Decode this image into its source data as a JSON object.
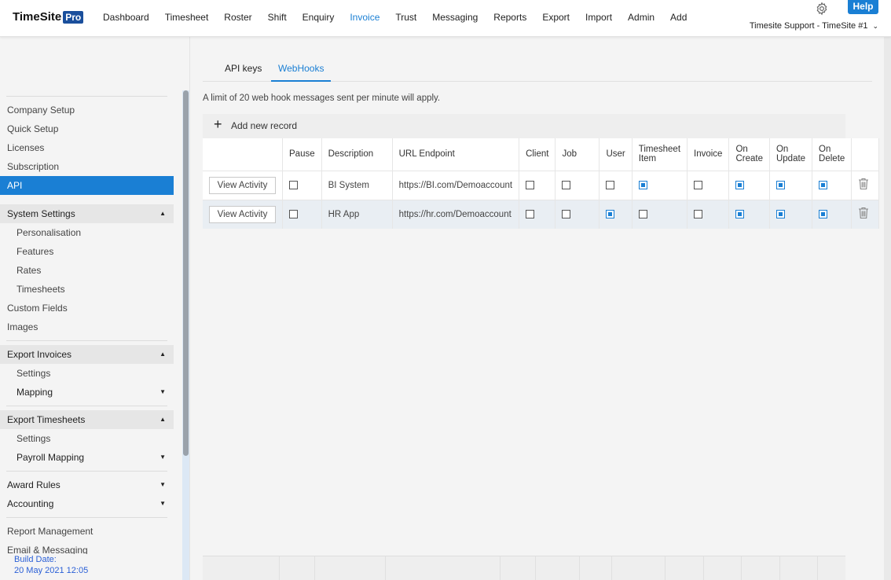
{
  "header": {
    "logo_text": "TimeSite",
    "logo_badge": "Pro",
    "nav": [
      "Dashboard",
      "Timesheet",
      "Roster",
      "Shift",
      "Enquiry",
      "Invoice",
      "Trust",
      "Messaging",
      "Reports",
      "Export",
      "Import",
      "Admin",
      "Add"
    ],
    "active_nav": "Invoice",
    "help_label": "Help",
    "account_label": "Timesite Support - TimeSite #1",
    "accent_color": "#1a7fd4"
  },
  "sidebar": {
    "items": [
      {
        "label": "Company Setup"
      },
      {
        "label": "Quick Setup"
      },
      {
        "label": "Licenses"
      },
      {
        "label": "Subscription"
      },
      {
        "label": "API"
      },
      {
        "label": "System Settings"
      },
      {
        "label": "Personalisation"
      },
      {
        "label": "Features"
      },
      {
        "label": "Rates"
      },
      {
        "label": "Timesheets"
      },
      {
        "label": "Custom Fields"
      },
      {
        "label": "Images"
      },
      {
        "label": "Export Invoices"
      },
      {
        "label": "Settings"
      },
      {
        "label": "Mapping"
      },
      {
        "label": "Export Timesheets"
      },
      {
        "label": "Settings"
      },
      {
        "label": "Payroll Mapping"
      },
      {
        "label": "Award Rules"
      },
      {
        "label": "Accounting"
      },
      {
        "label": "Report Management"
      },
      {
        "label": "Email & Messaging"
      }
    ],
    "build_label": "Build Date:",
    "build_date": "20 May 2021 12:05"
  },
  "main": {
    "tabs": [
      {
        "label": "API keys"
      },
      {
        "label": "WebHooks"
      }
    ],
    "active_tab": "WebHooks",
    "limit_note": "A limit of 20 web hook messages sent per minute will apply.",
    "add_label": "Add new record",
    "columns": [
      "",
      "Pause",
      "Description",
      "URL Endpoint",
      "Client",
      "Job",
      "User",
      "Timesheet Item",
      "Invoice",
      "On Create",
      "On Update",
      "On Delete",
      ""
    ],
    "rows": [
      {
        "action": "View Activity",
        "pause": false,
        "description": "BI System",
        "url": "https://BI.com/Demoaccount",
        "client": false,
        "job": false,
        "user": false,
        "timesheet_item": true,
        "invoice": false,
        "on_create": true,
        "on_update": true,
        "on_delete": true
      },
      {
        "action": "View Activity",
        "pause": false,
        "description": "HR App",
        "url": "https://hr.com/Demoaccount",
        "client": false,
        "job": false,
        "user": true,
        "timesheet_item": false,
        "invoice": false,
        "on_create": true,
        "on_update": true,
        "on_delete": true
      }
    ]
  }
}
